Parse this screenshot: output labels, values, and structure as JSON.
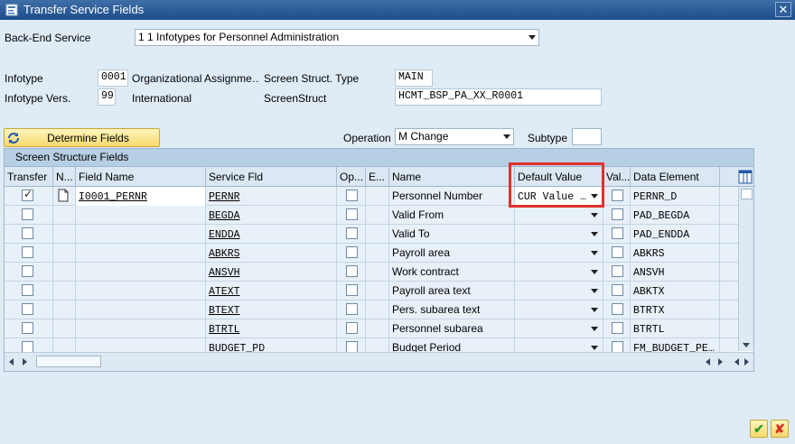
{
  "window": {
    "title": "Transfer Service Fields",
    "close_glyph": "✕"
  },
  "form": {
    "backend_service_label": "Back-End Service",
    "backend_service_value": "1 1 Infotypes for Personnel Administration",
    "infotype_label": "Infotype",
    "infotype_value": "0001",
    "infotype_text": "Organizational Assignme…",
    "infotype_vers_label": "Infotype Vers.",
    "infotype_vers_value": "99",
    "infotype_vers_text": "International",
    "screen_struct_type_label": "Screen Struct. Type",
    "screen_struct_type_value": "MAIN",
    "screen_struct_label": "ScreenStruct",
    "screen_struct_value": "HCMT_BSP_PA_XX_R0001",
    "determine_fields_label": "Determine Fields",
    "operation_label": "Operation",
    "operation_value": "M Change",
    "subtype_label": "Subtype",
    "subtype_value": ""
  },
  "table": {
    "title": "Screen Structure Fields",
    "columns": [
      "Transfer",
      "N...",
      "Field Name",
      "Service Fld",
      "Op...",
      "E...",
      "Name",
      "Default Value",
      "Val...",
      "Data Element"
    ],
    "rows": [
      {
        "transfer": true,
        "doc": true,
        "field_name": "I0001_PERNR",
        "service_fld": "PERNR",
        "name": "Personnel Number",
        "default": "CUR Value …",
        "data_element": "PERNR_D"
      },
      {
        "transfer": false,
        "doc": false,
        "field_name": "",
        "service_fld": "BEGDA",
        "name": "Valid From",
        "default": "",
        "data_element": "PAD_BEGDA"
      },
      {
        "transfer": false,
        "doc": false,
        "field_name": "",
        "service_fld": "ENDDA",
        "name": "Valid To",
        "default": "",
        "data_element": "PAD_ENDDA"
      },
      {
        "transfer": false,
        "doc": false,
        "field_name": "",
        "service_fld": "ABKRS",
        "name": "Payroll area",
        "default": "",
        "data_element": "ABKRS"
      },
      {
        "transfer": false,
        "doc": false,
        "field_name": "",
        "service_fld": "ANSVH",
        "name": "Work contract",
        "default": "",
        "data_element": "ANSVH"
      },
      {
        "transfer": false,
        "doc": false,
        "field_name": "",
        "service_fld": "ATEXT",
        "name": "Payroll area text",
        "default": "",
        "data_element": "ABKTX"
      },
      {
        "transfer": false,
        "doc": false,
        "field_name": "",
        "service_fld": "BTEXT",
        "name": "Pers. subarea text",
        "default": "",
        "data_element": "BTRTX"
      },
      {
        "transfer": false,
        "doc": false,
        "field_name": "",
        "service_fld": "BTRTL",
        "name": "Personnel subarea",
        "default": "",
        "data_element": "BTRTL"
      },
      {
        "transfer": false,
        "doc": false,
        "field_name": "",
        "service_fld": "BUDGET_PD",
        "name": "Budget Period",
        "default": "",
        "data_element": "FM_BUDGET_PE…"
      }
    ]
  },
  "footer": {
    "ok_glyph": "✔",
    "cancel_glyph": "✘"
  },
  "colors": {
    "highlight": "#e0312d",
    "title_bar": "#1d4d8a",
    "button_yellow": "#f7d96c"
  }
}
